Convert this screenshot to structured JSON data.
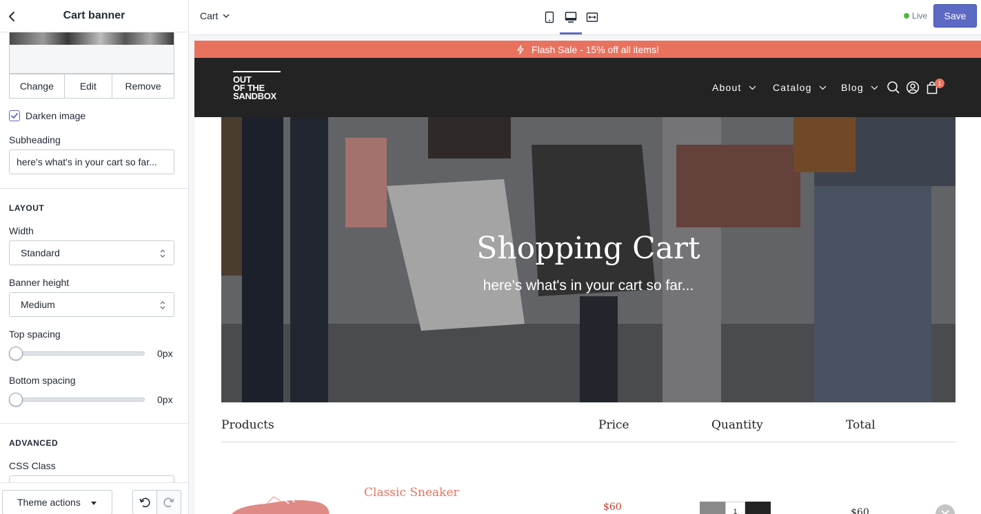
{
  "sidebar": {
    "title": "Cart banner",
    "image_actions": {
      "change": "Change",
      "edit": "Edit",
      "remove": "Remove"
    },
    "darken_image": {
      "label": "Darken image",
      "checked": true
    },
    "subheading": {
      "label": "Subheading",
      "value": "here's what's in your cart so far..."
    },
    "layout": {
      "section_title": "LAYOUT",
      "width": {
        "label": "Width",
        "value": "Standard"
      },
      "banner_height": {
        "label": "Banner height",
        "value": "Medium"
      },
      "top_spacing": {
        "label": "Top spacing",
        "value": "0px",
        "level": 0
      },
      "bottom_spacing": {
        "label": "Bottom spacing",
        "value": "0px",
        "level": 0
      }
    },
    "advanced": {
      "section_title": "ADVANCED",
      "css_class": {
        "label": "CSS Class",
        "value": ""
      }
    },
    "footer": {
      "theme_actions": "Theme actions"
    }
  },
  "topbar": {
    "page": "Cart",
    "status": "Live",
    "save": "Save"
  },
  "store": {
    "announcement": "Flash Sale - 15% off all items!",
    "logo_lines": [
      "OUT",
      "OF THE",
      "SANDBOX"
    ],
    "nav": [
      "About",
      "Catalog",
      "Blog"
    ],
    "cart_count": "1",
    "banner": {
      "title": "Shopping Cart",
      "subtitle": "here's what's in your cart so far..."
    },
    "table_headers": {
      "products": "Products",
      "price": "Price",
      "quantity": "Quantity",
      "total": "Total"
    },
    "item": {
      "name": "Classic Sneaker",
      "price": "$60",
      "quantity": "1",
      "total": "$60"
    }
  },
  "colors": {
    "accent": "#5c6ac4",
    "brand": "#e9725f",
    "header_bg": "#232323",
    "live": "#50b83c"
  }
}
